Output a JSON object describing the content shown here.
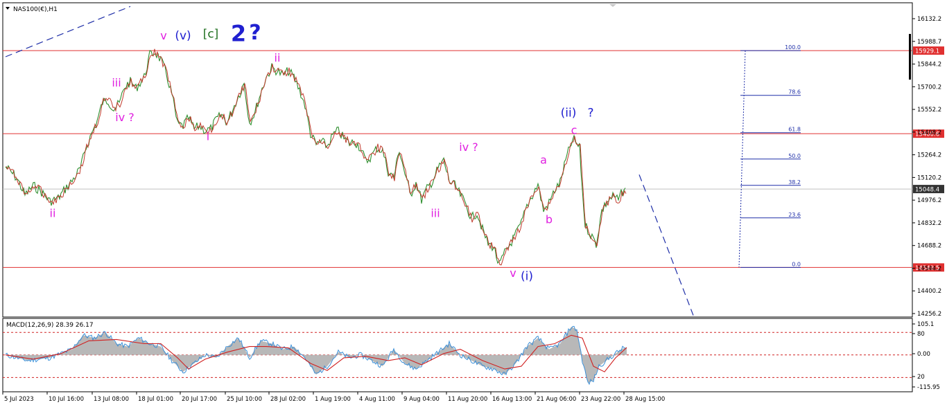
{
  "header": {
    "symbol_label": "NAS100(€),H1"
  },
  "chart_data": {
    "type": "line",
    "symbol": "NAS100(€)",
    "timeframe": "H1",
    "ylim": [
      14256.2,
      16132.2
    ],
    "y_ticks": [
      "16132.2",
      "15988.7",
      "15844.2",
      "15700.2",
      "15552.2",
      "15408.2",
      "15264.2",
      "15120.2",
      "14976.2",
      "14832.2",
      "14688.2",
      "14544.2",
      "14400.2",
      "14256.2"
    ],
    "x_ticks": [
      "5 Jul 2023",
      "10 Jul 16:00",
      "13 Jul 08:00",
      "18 Jul 01:00",
      "20 Jul 17:00",
      "25 Jul 10:00",
      "28 Jul 02:00",
      "1 Aug 19:00",
      "4 Aug 11:00",
      "9 Aug 04:00",
      "11 Aug 20:00",
      "16 Aug 13:00",
      "21 Aug 06:00",
      "23 Aug 22:00",
      "28 Aug 15:00"
    ],
    "horizontal_levels": [
      {
        "price": 15929.1,
        "label": "15929.1",
        "color": "#e03030"
      },
      {
        "price": 15400.6,
        "label": "15400.6",
        "color": "#e03030"
      },
      {
        "price": 14549.5,
        "label": "14549.5",
        "color": "#e03030"
      },
      {
        "price": 15048.4,
        "label": "15048.4",
        "color": "#333333"
      }
    ],
    "fibonacci_levels": [
      {
        "level": "100.0",
        "price": 15929.1
      },
      {
        "level": "78.6",
        "price": 15644.6
      },
      {
        "level": "61.8",
        "price": 15406.7
      },
      {
        "level": "50.0",
        "price": 15239.3
      },
      {
        "level": "38.2",
        "price": 15071.9
      },
      {
        "level": "23.6",
        "price": 14864.9
      },
      {
        "level": "0.0",
        "price": 14549.5
      }
    ],
    "price_path": [
      [
        0,
        15190
      ],
      [
        4,
        15120
      ],
      [
        7,
        15010
      ],
      [
        10,
        15070
      ],
      [
        13,
        15030
      ],
      [
        16,
        14970
      ],
      [
        19,
        14990
      ],
      [
        22,
        15060
      ],
      [
        24,
        15100
      ],
      [
        27,
        15180
      ],
      [
        29,
        15310
      ],
      [
        31,
        15400
      ],
      [
        33,
        15480
      ],
      [
        35,
        15600
      ],
      [
        37,
        15610
      ],
      [
        39,
        15560
      ],
      [
        41,
        15590
      ],
      [
        43,
        15700
      ],
      [
        45,
        15730
      ],
      [
        47,
        15690
      ],
      [
        50,
        15760
      ],
      [
        52,
        15900
      ],
      [
        54,
        15920
      ],
      [
        56,
        15870
      ],
      [
        58,
        15780
      ],
      [
        60,
        15650
      ],
      [
        62,
        15460
      ],
      [
        64,
        15450
      ],
      [
        66,
        15500
      ],
      [
        68,
        15430
      ],
      [
        70,
        15450
      ],
      [
        72,
        15420
      ],
      [
        74,
        15430
      ],
      [
        76,
        15490
      ],
      [
        78,
        15520
      ],
      [
        80,
        15470
      ],
      [
        82,
        15560
      ],
      [
        84,
        15640
      ],
      [
        86,
        15720
      ],
      [
        88,
        15470
      ],
      [
        90,
        15540
      ],
      [
        92,
        15660
      ],
      [
        94,
        15760
      ],
      [
        96,
        15820
      ],
      [
        98,
        15800
      ],
      [
        100,
        15770
      ],
      [
        102,
        15800
      ],
      [
        104,
        15760
      ],
      [
        106,
        15680
      ],
      [
        108,
        15580
      ],
      [
        110,
        15400
      ],
      [
        112,
        15330
      ],
      [
        114,
        15350
      ],
      [
        116,
        15320
      ],
      [
        118,
        15390
      ],
      [
        120,
        15420
      ],
      [
        122,
        15370
      ],
      [
        124,
        15340
      ],
      [
        126,
        15350
      ],
      [
        128,
        15310
      ],
      [
        130,
        15220
      ],
      [
        132,
        15260
      ],
      [
        134,
        15310
      ],
      [
        136,
        15290
      ],
      [
        138,
        15160
      ],
      [
        140,
        15120
      ],
      [
        142,
        15300
      ],
      [
        144,
        15150
      ],
      [
        146,
        15010
      ],
      [
        148,
        15090
      ],
      [
        150,
        14980
      ],
      [
        152,
        15050
      ],
      [
        154,
        15100
      ],
      [
        156,
        15180
      ],
      [
        158,
        15230
      ],
      [
        160,
        15100
      ],
      [
        162,
        15070
      ],
      [
        164,
        15010
      ],
      [
        166,
        14950
      ],
      [
        168,
        14860
      ],
      [
        170,
        14900
      ],
      [
        172,
        14790
      ],
      [
        174,
        14700
      ],
      [
        176,
        14680
      ],
      [
        178,
        14560
      ],
      [
        180,
        14640
      ],
      [
        182,
        14700
      ],
      [
        184,
        14760
      ],
      [
        186,
        14830
      ],
      [
        188,
        14940
      ],
      [
        190,
        15010
      ],
      [
        192,
        15080
      ],
      [
        194,
        14910
      ],
      [
        196,
        14960
      ],
      [
        198,
        15040
      ],
      [
        200,
        15090
      ],
      [
        202,
        15230
      ],
      [
        204,
        15340
      ],
      [
        205,
        15360
      ],
      [
        207,
        15310
      ],
      [
        208,
        15040
      ],
      [
        209,
        14820
      ],
      [
        211,
        14760
      ],
      [
        213,
        14700
      ],
      [
        215,
        14910
      ],
      [
        217,
        14970
      ],
      [
        219,
        15000
      ],
      [
        221,
        14980
      ],
      [
        223,
        15050
      ],
      [
        224,
        15030
      ]
    ],
    "projection": [
      [
        224,
        15140
      ],
      [
        245,
        14245
      ]
    ],
    "upper_trend": [
      [
        0,
        15890
      ],
      [
        45,
        16210
      ]
    ],
    "wave_labels": [
      {
        "text": "v",
        "x": 57,
        "price": 16000,
        "color": "#e020e0"
      },
      {
        "text": "(v)",
        "x": 64,
        "price": 16000,
        "color": "#2020d0"
      },
      {
        "text": "[c]",
        "x": 74,
        "price": 16010,
        "color": "#207020"
      },
      {
        "text": "2",
        "x": 84,
        "price": 15990,
        "color": "#2020d0"
      },
      {
        "text": "?",
        "x": 90,
        "price": 16000,
        "color": "#2020d0"
      },
      {
        "text": "iii",
        "x": 40,
        "price": 15700,
        "color": "#e020e0"
      },
      {
        "text": "iv ?",
        "x": 43,
        "price": 15480,
        "color": "#e020e0"
      },
      {
        "text": "ii",
        "x": 17,
        "price": 14870,
        "color": "#e020e0"
      },
      {
        "text": "i",
        "x": 73,
        "price": 15360,
        "color": "#e020e0"
      },
      {
        "text": "ii",
        "x": 98,
        "price": 15860,
        "color": "#e020e0"
      },
      {
        "text": "iii",
        "x": 155,
        "price": 14870,
        "color": "#e020e0"
      },
      {
        "text": "iv ?",
        "x": 167,
        "price": 15290,
        "color": "#e020e0"
      },
      {
        "text": "v",
        "x": 183,
        "price": 14490,
        "color": "#e020e0"
      },
      {
        "text": "(i)",
        "x": 188,
        "price": 14470,
        "color": "#2020d0"
      },
      {
        "text": "a",
        "x": 194,
        "price": 15210,
        "color": "#e020e0"
      },
      {
        "text": "b",
        "x": 196,
        "price": 14830,
        "color": "#e020e0"
      },
      {
        "text": "c",
        "x": 205,
        "price": 15400,
        "color": "#e020e0"
      },
      {
        "text": "(ii)",
        "x": 203,
        "price": 15510,
        "color": "#2020d0"
      },
      {
        "text": "?",
        "x": 211,
        "price": 15510,
        "color": "#2020d0"
      }
    ],
    "indicator": {
      "name": "MACD(12,26,9)",
      "values": "28.39 26.17",
      "label": "MACD(12,26,9) 28.39 26.17",
      "ylim": [
        -115.95,
        105.1
      ],
      "y_ticks": [
        "105.1",
        "80",
        "0.00",
        "20",
        "-115.95"
      ],
      "levels": [
        80,
        0,
        -80
      ],
      "series": [
        {
          "name": "MACD",
          "values": [
            [
              0,
              0
            ],
            [
              8,
              -20
            ],
            [
              16,
              -10
            ],
            [
              24,
              20
            ],
            [
              28,
              70
            ],
            [
              32,
              60
            ],
            [
              36,
              80
            ],
            [
              40,
              40
            ],
            [
              44,
              30
            ],
            [
              48,
              60
            ],
            [
              52,
              40
            ],
            [
              56,
              30
            ],
            [
              60,
              -20
            ],
            [
              64,
              -60
            ],
            [
              68,
              -30
            ],
            [
              72,
              0
            ],
            [
              76,
              -10
            ],
            [
              80,
              30
            ],
            [
              84,
              60
            ],
            [
              88,
              -10
            ],
            [
              92,
              50
            ],
            [
              96,
              40
            ],
            [
              100,
              20
            ],
            [
              104,
              30
            ],
            [
              108,
              -10
            ],
            [
              112,
              -70
            ],
            [
              116,
              -40
            ],
            [
              120,
              10
            ],
            [
              124,
              -10
            ],
            [
              128,
              0
            ],
            [
              132,
              -20
            ],
            [
              136,
              -40
            ],
            [
              140,
              20
            ],
            [
              144,
              -30
            ],
            [
              148,
              -50
            ],
            [
              152,
              -20
            ],
            [
              156,
              10
            ],
            [
              160,
              40
            ],
            [
              164,
              0
            ],
            [
              168,
              -20
            ],
            [
              172,
              -40
            ],
            [
              176,
              -50
            ],
            [
              180,
              -70
            ],
            [
              184,
              -30
            ],
            [
              188,
              30
            ],
            [
              192,
              60
            ],
            [
              196,
              20
            ],
            [
              200,
              40
            ],
            [
              204,
              100
            ],
            [
              206,
              90
            ],
            [
              208,
              -20
            ],
            [
              210,
              -100
            ],
            [
              212,
              -90
            ],
            [
              214,
              -40
            ],
            [
              218,
              -10
            ],
            [
              222,
              20
            ],
            [
              224,
              28
            ]
          ]
        },
        {
          "name": "Signal",
          "values": [
            [
              0,
              0
            ],
            [
              10,
              -15
            ],
            [
              20,
              5
            ],
            [
              30,
              50
            ],
            [
              40,
              55
            ],
            [
              50,
              40
            ],
            [
              56,
              40
            ],
            [
              62,
              -10
            ],
            [
              66,
              -50
            ],
            [
              72,
              -15
            ],
            [
              80,
              10
            ],
            [
              88,
              30
            ],
            [
              94,
              30
            ],
            [
              102,
              25
            ],
            [
              110,
              -30
            ],
            [
              116,
              -55
            ],
            [
              122,
              -10
            ],
            [
              130,
              -5
            ],
            [
              138,
              -20
            ],
            [
              144,
              -10
            ],
            [
              150,
              -35
            ],
            [
              158,
              5
            ],
            [
              164,
              20
            ],
            [
              172,
              -20
            ],
            [
              180,
              -50
            ],
            [
              186,
              -40
            ],
            [
              192,
              30
            ],
            [
              198,
              40
            ],
            [
              204,
              70
            ],
            [
              208,
              60
            ],
            [
              212,
              -40
            ],
            [
              216,
              -60
            ],
            [
              220,
              -10
            ],
            [
              224,
              26
            ]
          ]
        }
      ]
    }
  }
}
